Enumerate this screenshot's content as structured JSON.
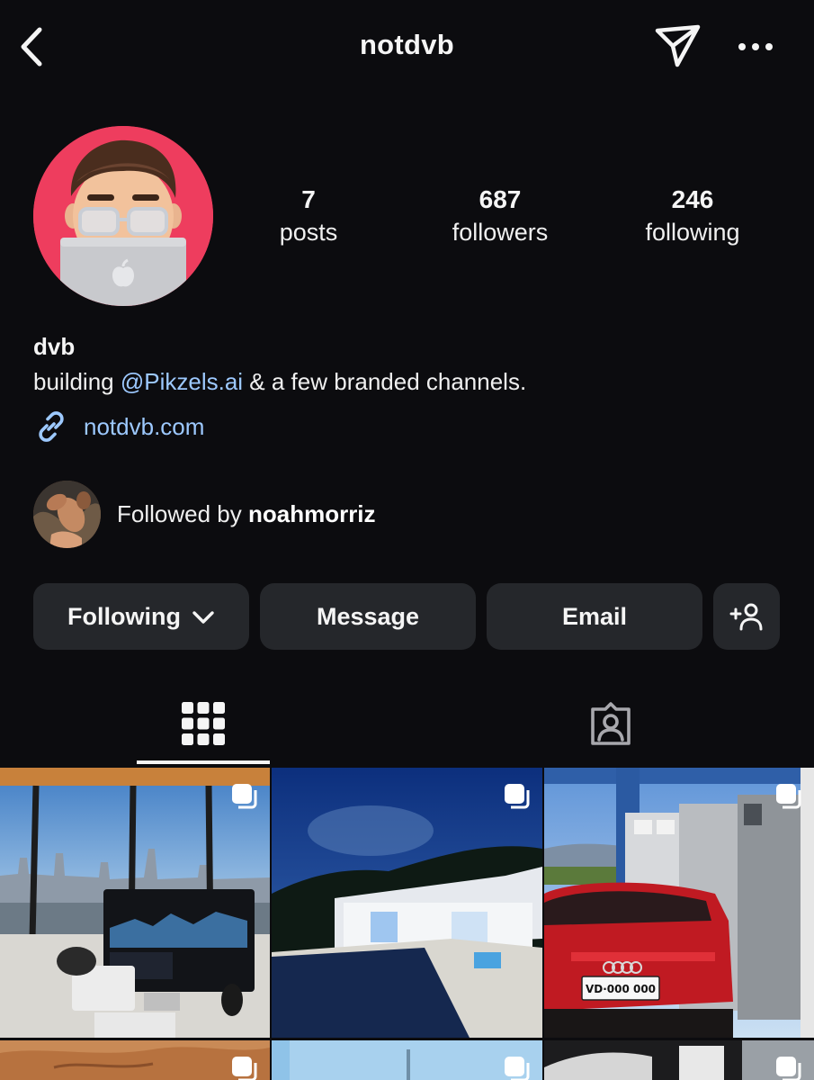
{
  "header": {
    "username": "notdvb"
  },
  "profile": {
    "stats": [
      {
        "value": "7",
        "label": "posts"
      },
      {
        "value": "687",
        "label": "followers"
      },
      {
        "value": "246",
        "label": "following"
      }
    ],
    "display_name": "dvb",
    "bio": {
      "prefix": "building ",
      "mention": "@Pikzels.ai",
      "suffix": " & a few branded channels."
    },
    "link": "notdvb.com",
    "followed_by": {
      "prefix": "Followed by ",
      "user": "noahmorriz"
    }
  },
  "actions": {
    "following_label": "Following",
    "message_label": "Message",
    "email_label": "Email"
  },
  "grid": {
    "posts": [
      {
        "plate": "",
        "multi": true
      },
      {
        "plate": "",
        "multi": true
      },
      {
        "plate": "VD·000 000",
        "multi": true
      },
      {
        "plate": "",
        "multi": true
      },
      {
        "plate": "",
        "multi": true
      },
      {
        "plate": "",
        "multi": true
      }
    ]
  },
  "colors": {
    "background": "#0c0c0f",
    "button": "#25272b",
    "link": "#9dc9ff",
    "avatar_bg": "#ee3d5e"
  },
  "icons": [
    "chevron-left-icon",
    "send-icon",
    "more-icon",
    "link-icon",
    "chevron-down-icon",
    "add-person-icon",
    "grid-icon",
    "tagged-icon",
    "multi-post-icon"
  ]
}
